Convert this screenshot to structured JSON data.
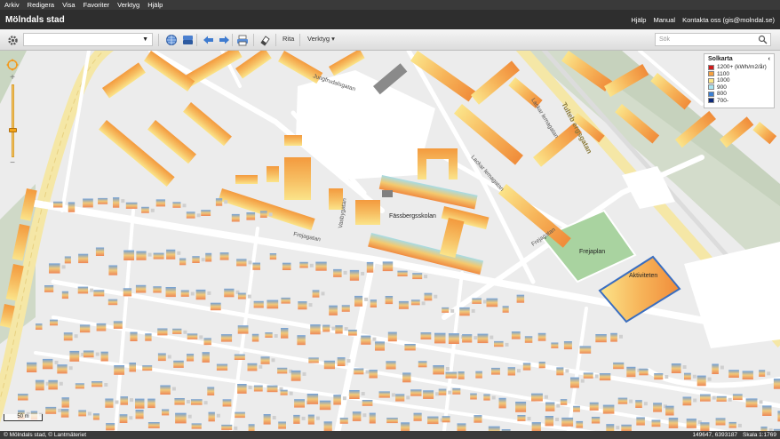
{
  "menu": [
    "Arkiv",
    "Redigera",
    "Visa",
    "Favoriter",
    "Verktyg",
    "Hjälp"
  ],
  "app": {
    "title": "Mölndals stad",
    "links": [
      "Hjälp",
      "Manual",
      "Kontakta oss (gis@molndal.se)"
    ]
  },
  "toolbar": {
    "rita_label": "Rita",
    "verktyg_label": "Verktyg",
    "search_placeholder": "Sök"
  },
  "legend": {
    "title": "Solkarta",
    "collapse": "‹",
    "items": [
      {
        "label": "1200+ (kWh/m2/år)",
        "color": "#d01c1c"
      },
      {
        "label": "1100",
        "color": "#f5a040"
      },
      {
        "label": "1000",
        "color": "#fbe68a"
      },
      {
        "label": "900",
        "color": "#a9e4f0"
      },
      {
        "label": "800",
        "color": "#3a7fd4"
      },
      {
        "label": "700-",
        "color": "#0d2a7a"
      }
    ]
  },
  "map_labels": {
    "school": "Fässbergsskolan",
    "field": "Frejaplan",
    "arena": "Aktiviteten",
    "street_tulteb": "Tulteb ergsgatan",
    "street_lackar1": "Lackar lemagatan",
    "street_lackar2": "Lackar lemagatan",
    "street_frejagatan": "Frejagatan",
    "street_jung": "Jungfrudalsgatan",
    "street_freja2": "Frejagatan",
    "street_vasby": "Vasbygatan"
  },
  "scale": {
    "label": "50 m"
  },
  "status": {
    "left": "© Mölndals stad, © Lantmäteriet",
    "coords": "149647, 6393187",
    "scale": "Skala 1:1769"
  }
}
